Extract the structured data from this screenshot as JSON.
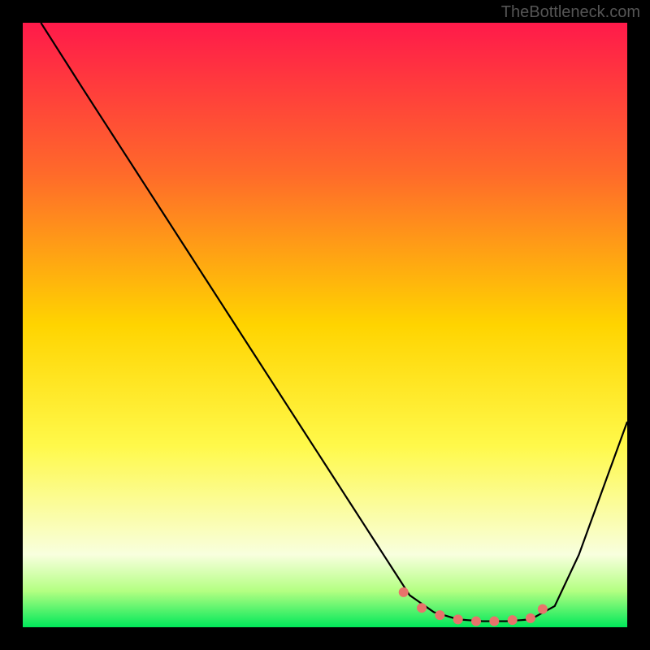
{
  "watermark": "TheBottleneck.com",
  "chart_data": {
    "type": "line",
    "title": "",
    "xlabel": "",
    "ylabel": "",
    "xlim": [
      0,
      100
    ],
    "ylim": [
      0,
      100
    ],
    "gradient_stops": [
      {
        "offset": 0,
        "color": "#ff1a4a"
      },
      {
        "offset": 25,
        "color": "#ff6a2a"
      },
      {
        "offset": 50,
        "color": "#ffd400"
      },
      {
        "offset": 70,
        "color": "#fff94a"
      },
      {
        "offset": 88,
        "color": "#f8ffde"
      },
      {
        "offset": 94,
        "color": "#b4ff82"
      },
      {
        "offset": 100,
        "color": "#00e85a"
      }
    ],
    "series": [
      {
        "name": "curve",
        "x": [
          3,
          10,
          20,
          30,
          40,
          50,
          60,
          64,
          68,
          72,
          76,
          80,
          84,
          88,
          92,
          96,
          100
        ],
        "y": [
          100,
          89,
          73.5,
          58,
          42.5,
          27,
          11.5,
          5.3,
          2.5,
          1.3,
          1.0,
          1.0,
          1.3,
          3.5,
          12,
          23,
          34
        ]
      }
    ],
    "markers": {
      "name": "highlight-points",
      "x": [
        63,
        66,
        69,
        72,
        75,
        78,
        81,
        84,
        86
      ],
      "y": [
        5.8,
        3.2,
        2.0,
        1.3,
        1.0,
        1.0,
        1.2,
        1.5,
        3.0
      ]
    }
  }
}
